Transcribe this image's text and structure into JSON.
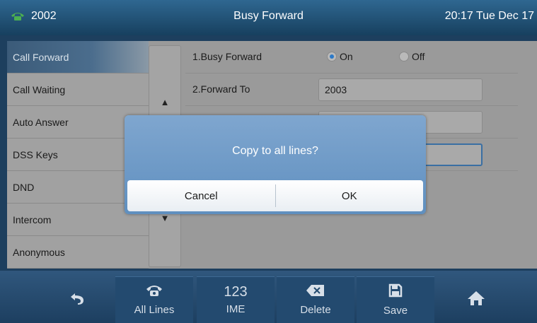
{
  "topbar": {
    "line": "2002",
    "title": "Busy Forward",
    "clock": "20:17 Tue Dec 17"
  },
  "sidebar": {
    "items": [
      {
        "label": "Call Forward"
      },
      {
        "label": "Call Waiting"
      },
      {
        "label": "Auto Answer"
      },
      {
        "label": "DSS Keys"
      },
      {
        "label": "DND"
      },
      {
        "label": "Intercom"
      },
      {
        "label": "Anonymous"
      }
    ]
  },
  "scroll": {
    "up": "▲",
    "down": "▼"
  },
  "content": {
    "busy_forward_label": "1.Busy Forward",
    "on_label": "On",
    "off_label": "Off",
    "forward_to_label": "2.Forward To",
    "forward_to_value": "2003"
  },
  "dialog": {
    "message": "Copy to all lines?",
    "cancel": "Cancel",
    "ok": "OK"
  },
  "softkeys": {
    "back_icon": "back-arrow-icon",
    "all_lines": "All Lines",
    "ime_top": "123",
    "ime": "IME",
    "delete": "Delete",
    "save": "Save",
    "home_icon": "home-icon"
  },
  "colors": {
    "accent": "#2b79c8",
    "header": "#2f6791",
    "dialog": "#6f9ac7"
  }
}
